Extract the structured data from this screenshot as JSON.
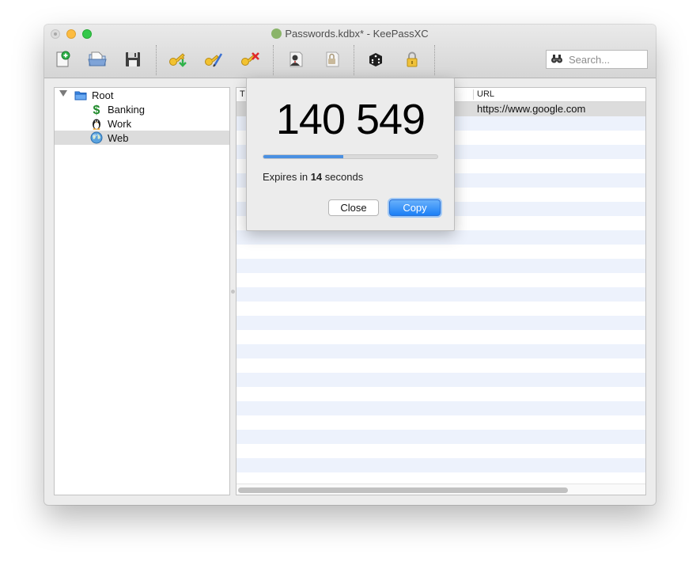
{
  "window": {
    "title": "Passwords.kdbx* - KeePassXC"
  },
  "toolbar": {
    "buttons": [
      {
        "name": "new-database",
        "icon": "new-database-icon"
      },
      {
        "name": "open-database",
        "icon": "open-database-icon"
      },
      {
        "name": "save-database",
        "icon": "save-icon"
      },
      {
        "name": "add-entry",
        "icon": "key-add-icon"
      },
      {
        "name": "edit-entry",
        "icon": "key-edit-icon"
      },
      {
        "name": "delete-entry",
        "icon": "key-delete-icon"
      },
      {
        "name": "copy-username",
        "icon": "copy-username-icon"
      },
      {
        "name": "copy-password",
        "icon": "copy-password-icon"
      },
      {
        "name": "password-generator",
        "icon": "dice-icon"
      },
      {
        "name": "lock-database",
        "icon": "lock-icon"
      }
    ],
    "search_placeholder": "Search..."
  },
  "groups": {
    "root": "Root",
    "children": [
      {
        "label": "Banking",
        "icon": "dollar-icon"
      },
      {
        "label": "Work",
        "icon": "penguin-icon"
      },
      {
        "label": "Web",
        "icon": "globe-icon",
        "selected": true
      }
    ]
  },
  "entries": {
    "columns": {
      "first_partial": "T",
      "url": "URL"
    },
    "rows": [
      {
        "url": "https://www.google.com",
        "selected": true
      }
    ]
  },
  "totp_popup": {
    "code": "140 549",
    "progress_fraction": 0.46,
    "expires_prefix": "Expires in ",
    "expires_seconds": "14",
    "expires_suffix": " seconds",
    "close_label": "Close",
    "copy_label": "Copy"
  },
  "colors": {
    "accent": "#1b7ff6",
    "progress": "#4a90e2",
    "row_stripe": "#edf2fc",
    "selection": "#dcdcdc"
  }
}
